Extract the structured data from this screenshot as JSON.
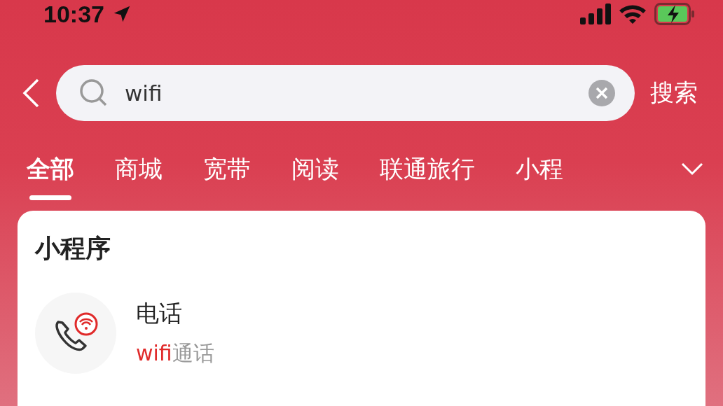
{
  "status_bar": {
    "time": "10:37"
  },
  "search": {
    "value": "wifi",
    "submit": "搜索"
  },
  "tabs": [
    {
      "label": "全部",
      "selected": true
    },
    {
      "label": "商城",
      "selected": false
    },
    {
      "label": "宽带",
      "selected": false
    },
    {
      "label": "阅读",
      "selected": false
    },
    {
      "label": "联通旅行",
      "selected": false
    },
    {
      "label": "小程",
      "selected": false
    }
  ],
  "section": {
    "title": "小程序",
    "items": [
      {
        "title": "电话",
        "subtitle_highlight": "wifi",
        "subtitle_rest": "通话"
      }
    ]
  }
}
